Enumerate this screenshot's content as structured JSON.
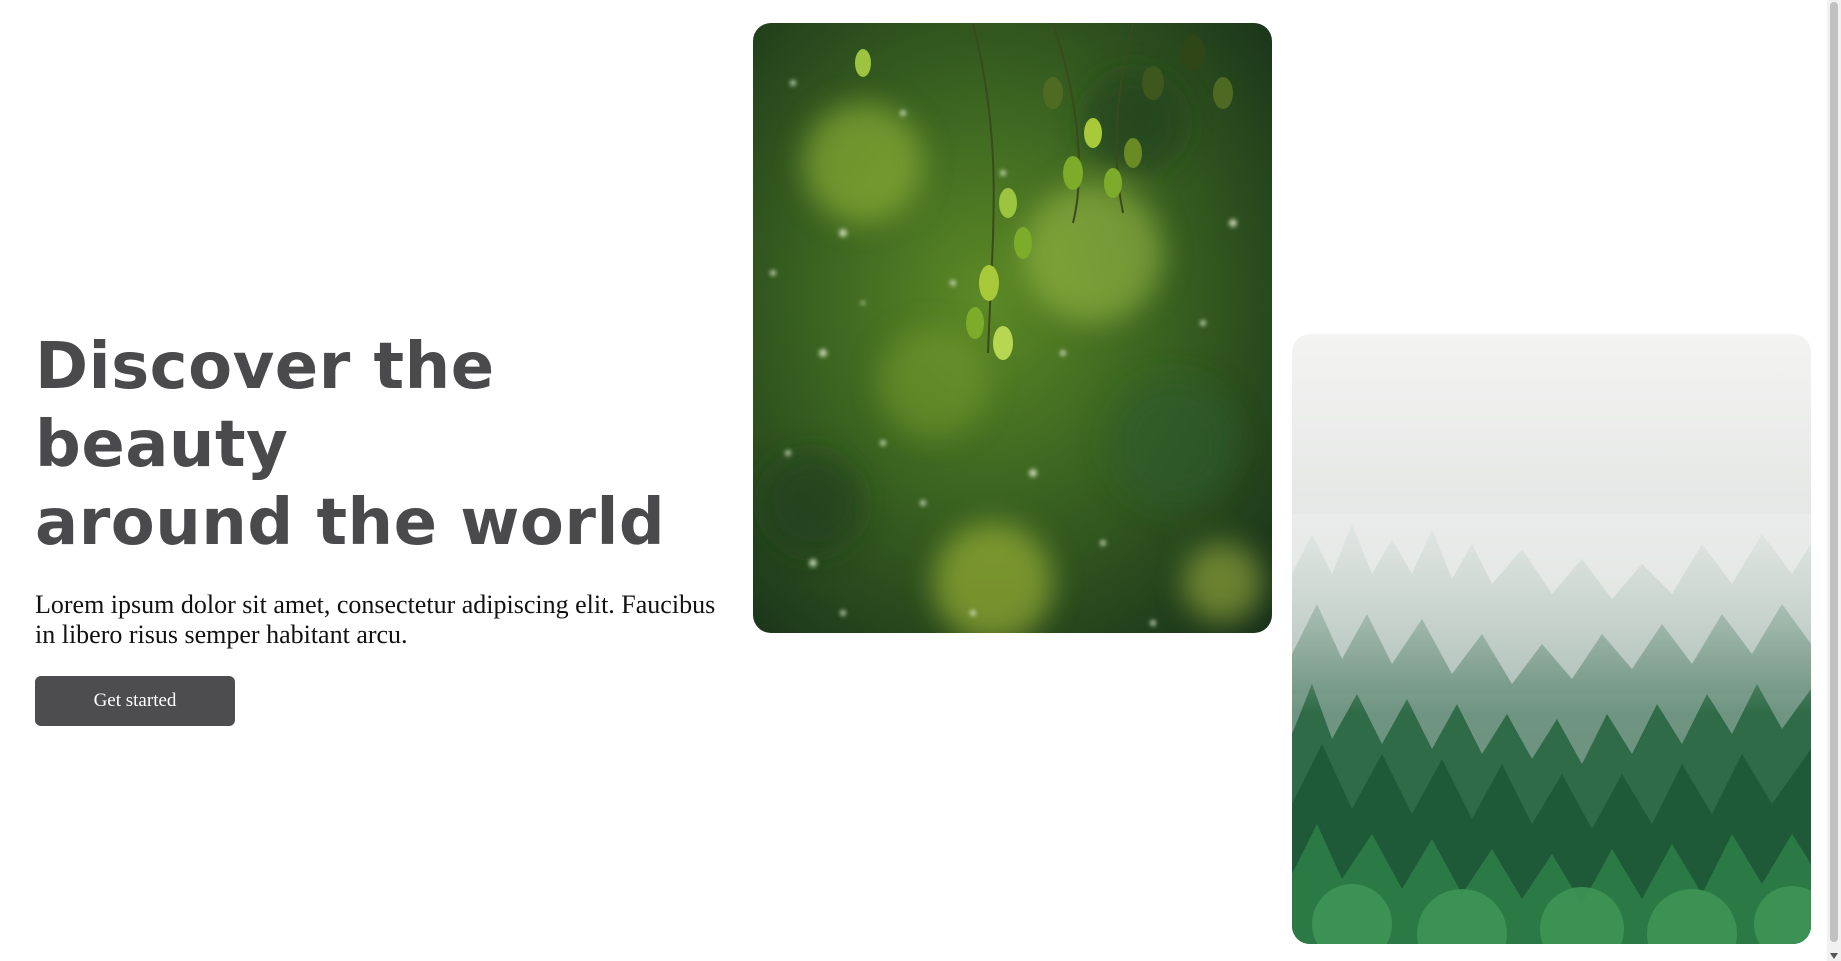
{
  "hero": {
    "headline_line1": "Discover the beauty",
    "headline_line2": "around the world",
    "body": "Lorem ipsum dolor sit amet, consectetur adipiscing elit. Faucibus in libero risus semper habitant arcu.",
    "cta_label": "Get started"
  },
  "images": [
    {
      "name": "leaves-bokeh-photo"
    },
    {
      "name": "misty-forest-photo"
    }
  ],
  "colors": {
    "headline": "#4a4a4c",
    "button_bg": "#4d4d4f",
    "button_text": "#ffffff",
    "page_bg": "#ffffff"
  }
}
